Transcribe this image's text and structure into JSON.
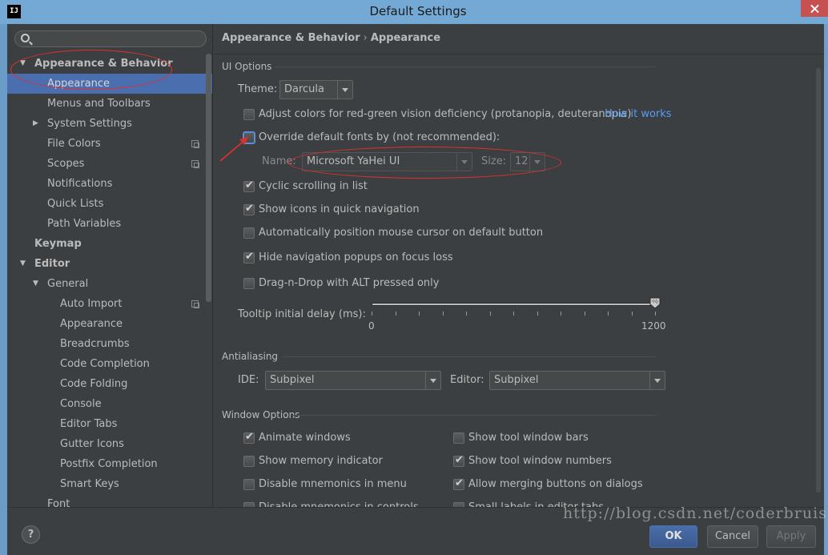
{
  "window": {
    "title": "Default Settings",
    "app_icon": "IJ"
  },
  "sidebar": {
    "search_placeholder": "",
    "items": [
      {
        "label": "Appearance & Behavior",
        "level": 0,
        "arrow": "▼",
        "bold": true,
        "selected": false,
        "copy": false
      },
      {
        "label": "Appearance",
        "level": 1,
        "arrow": "",
        "bold": false,
        "selected": true,
        "copy": false
      },
      {
        "label": "Menus and Toolbars",
        "level": 1,
        "arrow": "",
        "bold": false,
        "selected": false,
        "copy": false
      },
      {
        "label": "System Settings",
        "level": 1,
        "arrow": "▶",
        "bold": false,
        "selected": false,
        "copy": false
      },
      {
        "label": "File Colors",
        "level": 1,
        "arrow": "",
        "bold": false,
        "selected": false,
        "copy": true
      },
      {
        "label": "Scopes",
        "level": 1,
        "arrow": "",
        "bold": false,
        "selected": false,
        "copy": true
      },
      {
        "label": "Notifications",
        "level": 1,
        "arrow": "",
        "bold": false,
        "selected": false,
        "copy": false
      },
      {
        "label": "Quick Lists",
        "level": 1,
        "arrow": "",
        "bold": false,
        "selected": false,
        "copy": false
      },
      {
        "label": "Path Variables",
        "level": 1,
        "arrow": "",
        "bold": false,
        "selected": false,
        "copy": false
      },
      {
        "label": "Keymap",
        "level": 0,
        "arrow": "",
        "bold": true,
        "selected": false,
        "copy": false
      },
      {
        "label": "Editor",
        "level": 0,
        "arrow": "▼",
        "bold": true,
        "selected": false,
        "copy": false
      },
      {
        "label": "General",
        "level": 1,
        "arrow": "▼",
        "bold": false,
        "selected": false,
        "copy": false
      },
      {
        "label": "Auto Import",
        "level": 2,
        "arrow": "",
        "bold": false,
        "selected": false,
        "copy": true
      },
      {
        "label": "Appearance",
        "level": 2,
        "arrow": "",
        "bold": false,
        "selected": false,
        "copy": false
      },
      {
        "label": "Breadcrumbs",
        "level": 2,
        "arrow": "",
        "bold": false,
        "selected": false,
        "copy": false
      },
      {
        "label": "Code Completion",
        "level": 2,
        "arrow": "",
        "bold": false,
        "selected": false,
        "copy": false
      },
      {
        "label": "Code Folding",
        "level": 2,
        "arrow": "",
        "bold": false,
        "selected": false,
        "copy": false
      },
      {
        "label": "Console",
        "level": 2,
        "arrow": "",
        "bold": false,
        "selected": false,
        "copy": false
      },
      {
        "label": "Editor Tabs",
        "level": 2,
        "arrow": "",
        "bold": false,
        "selected": false,
        "copy": false
      },
      {
        "label": "Gutter Icons",
        "level": 2,
        "arrow": "",
        "bold": false,
        "selected": false,
        "copy": false
      },
      {
        "label": "Postfix Completion",
        "level": 2,
        "arrow": "",
        "bold": false,
        "selected": false,
        "copy": false
      },
      {
        "label": "Smart Keys",
        "level": 2,
        "arrow": "",
        "bold": false,
        "selected": false,
        "copy": false
      },
      {
        "label": "Font",
        "level": 1,
        "arrow": "",
        "bold": false,
        "selected": false,
        "copy": false
      }
    ]
  },
  "breadcrumb": {
    "parent": "Appearance & Behavior",
    "separator": "›",
    "current": "Appearance"
  },
  "ui_options": {
    "title": "UI Options",
    "theme_label": "Theme:",
    "theme_value": "Darcula",
    "adjust_colors_label": "Adjust colors for red-green vision deficiency (protanopia, deuteranopia)",
    "adjust_colors_checked": false,
    "how_it_works": "How it works",
    "override_fonts_label": "Override default fonts by (not recommended):",
    "override_fonts_checked": false,
    "name_label": "Name:",
    "name_value": "Microsoft YaHei UI",
    "size_label": "Size:",
    "size_value": "12",
    "cyclic_label": "Cyclic scrolling in list",
    "cyclic_checked": true,
    "show_icons_label": "Show icons in quick navigation",
    "show_icons_checked": true,
    "auto_position_label": "Automatically position mouse cursor on default button",
    "auto_position_checked": false,
    "hide_nav_label": "Hide navigation popups on focus loss",
    "hide_nav_checked": true,
    "drag_drop_label": "Drag-n-Drop with ALT pressed only",
    "drag_drop_checked": false,
    "tooltip_label": "Tooltip initial delay (ms):",
    "tooltip_min": "0",
    "tooltip_max": "1200",
    "tooltip_value": 1200
  },
  "antialiasing": {
    "title": "Antialiasing",
    "ide_label": "IDE:",
    "ide_value": "Subpixel",
    "editor_label": "Editor:",
    "editor_value": "Subpixel"
  },
  "window_options": {
    "title": "Window Options",
    "left": [
      {
        "label": "Animate windows",
        "checked": true
      },
      {
        "label": "Show memory indicator",
        "checked": false
      },
      {
        "label": "Disable mnemonics in menu",
        "checked": false
      },
      {
        "label": "Disable mnemonics in controls",
        "checked": false
      }
    ],
    "right": [
      {
        "label": "Show tool window bars",
        "checked": false
      },
      {
        "label": "Show tool window numbers",
        "checked": true
      },
      {
        "label": "Allow merging buttons on dialogs",
        "checked": true
      },
      {
        "label": "Small labels in editor tabs",
        "checked": false
      }
    ]
  },
  "buttons": {
    "help": "?",
    "ok": "OK",
    "cancel": "Cancel",
    "apply": "Apply"
  },
  "watermark": "http://blog.csdn.net/coderbruis",
  "colors": {
    "selection": "#4b6eaf",
    "link": "#589df6",
    "annotation": "#e0302e",
    "background": "#3c3f41"
  }
}
